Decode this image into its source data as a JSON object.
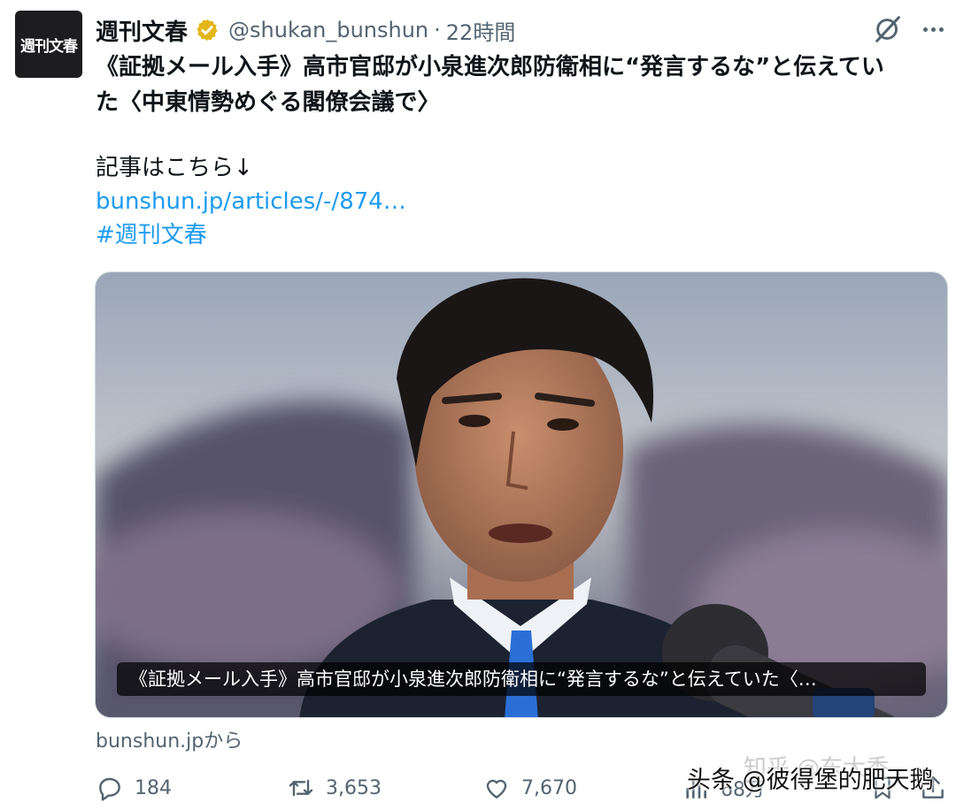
{
  "author": {
    "avatar_text": "週刊文春",
    "display_name": "週刊文春",
    "handle": "@shukan_bunshun",
    "separator": "·",
    "time": "22時間"
  },
  "icons": {
    "verified": "verified-badge-icon",
    "grok": "grok-icon",
    "more": "more-icon",
    "reply": "reply-icon",
    "repost": "repost-icon",
    "like": "like-icon",
    "views": "views-icon",
    "bookmark": "bookmark-icon",
    "share": "share-icon"
  },
  "colors": {
    "link": "#1d9bf0",
    "verified": "#e2b719",
    "muted": "#536471"
  },
  "tweet": {
    "text_line1": "《証拠メール入手》高市官邸が小泉進次郎防衛相に“発言するな”と伝えてい",
    "text_line2": "た〈中東情勢めぐる閣僚会議で〉",
    "body_label": "記事はこちら↓",
    "link": "bunshun.jp/articles/-/874…",
    "hashtag": "#週刊文春"
  },
  "card": {
    "caption": "《証拠メール入手》高市官邸が小泉進次郎防衛相に“発言するな”と伝えていた〈…",
    "source": "bunshun.jpから"
  },
  "actions": {
    "replies": "184",
    "reposts": "3,653",
    "likes": "7,670",
    "views": "68万"
  },
  "watermark": {
    "text": "头条 @彼得堡的肥天鹅",
    "faint_text": "知乎 @东大香"
  }
}
